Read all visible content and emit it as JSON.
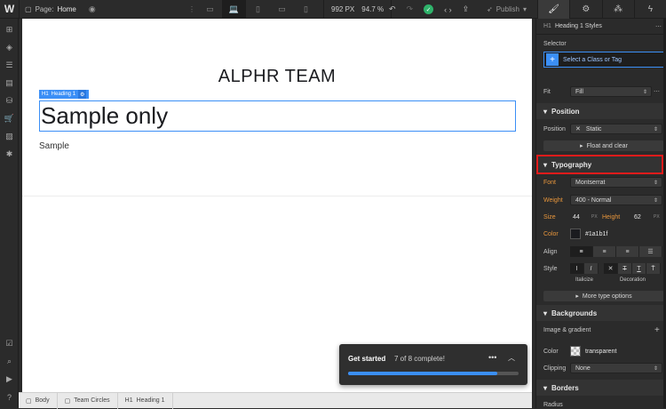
{
  "topbar": {
    "logo": "W",
    "page_label": "Page:",
    "page_name": "Home",
    "width": "992",
    "width_unit": "PX",
    "zoom": "94.7 %",
    "publish_label": "Publish"
  },
  "canvas": {
    "team_title": "ALPHR TEAM",
    "selection_badge": "Heading 1",
    "heading_text": "Sample only",
    "paragraph_text": "Sample"
  },
  "breadcrumb": {
    "items": [
      {
        "label": "Body"
      },
      {
        "label": "Team Circles"
      },
      {
        "label": "Heading 1"
      }
    ]
  },
  "get_started": {
    "title": "Get started",
    "progress_text": "7 of 8 complete!",
    "completed": 7,
    "total": 8
  },
  "panel": {
    "header": "Heading 1 Styles",
    "selector_label": "Selector",
    "selector_placeholder": "Select a Class or Tag",
    "fit_label": "Fit",
    "fit_value": "Fill",
    "position_section": "Position",
    "position_label": "Position",
    "position_value": "Static",
    "float_clear": "Float and clear",
    "typography_section": "Typography",
    "font_label": "Font",
    "font_value": "Montserrat",
    "weight_label": "Weight",
    "weight_value": "400 - Normal",
    "size_label": "Size",
    "size_value": "44",
    "size_unit": "PX",
    "height_label": "Height",
    "height_value": "62",
    "height_unit": "PX",
    "color_label": "Color",
    "color_value": "#1a1b1f",
    "align_label": "Align",
    "style_label": "Style",
    "italicize_label": "Italicize",
    "decoration_label": "Decoration",
    "more_type_options": "More type options",
    "backgrounds_section": "Backgrounds",
    "image_gradient_label": "Image & gradient",
    "bg_color_label": "Color",
    "bg_color_value": "transparent",
    "clipping_label": "Clipping",
    "clipping_value": "None",
    "borders_section": "Borders",
    "radius_label": "Radius"
  },
  "colors": {
    "accent": "#3b8ff6",
    "highlight": "#e21b1b",
    "heading_color": "#1a1b1f"
  }
}
